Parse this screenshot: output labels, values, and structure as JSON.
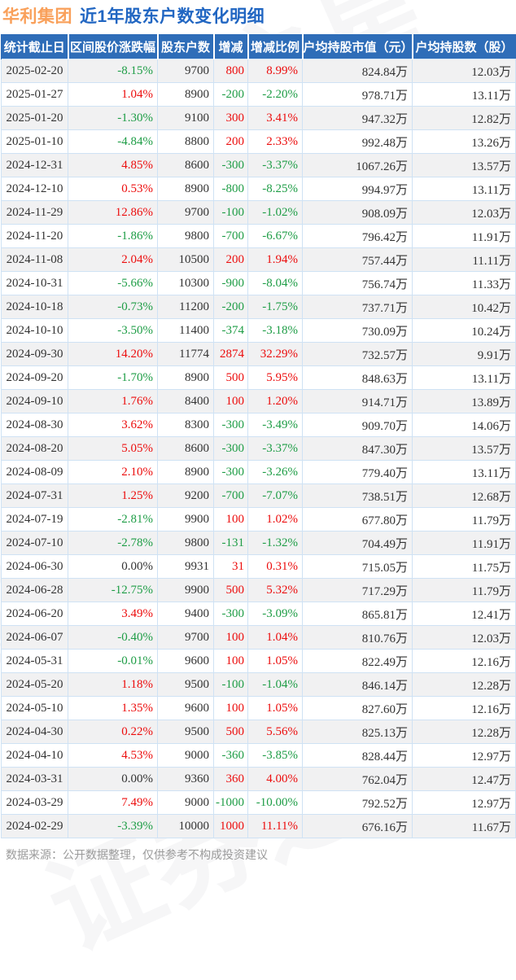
{
  "title": {
    "stock_name": "华利集团",
    "subtitle": "近1年股东户数变化明细"
  },
  "watermark": {
    "text": "证券之星"
  },
  "table": {
    "columns": [
      "统计截止日",
      "区间股价涨跌幅",
      "股东户数",
      "增减",
      "增减比例",
      "户均持股市值（元）",
      "户均持股数（股）"
    ],
    "rows": [
      [
        "2025-02-20",
        "-8.15%",
        "9700",
        "800",
        "8.99%",
        "824.84万",
        "12.03万"
      ],
      [
        "2025-01-27",
        "1.04%",
        "8900",
        "-200",
        "-2.20%",
        "978.71万",
        "13.11万"
      ],
      [
        "2025-01-20",
        "-1.30%",
        "9100",
        "300",
        "3.41%",
        "947.32万",
        "12.82万"
      ],
      [
        "2025-01-10",
        "-4.84%",
        "8800",
        "200",
        "2.33%",
        "992.48万",
        "13.26万"
      ],
      [
        "2024-12-31",
        "4.85%",
        "8600",
        "-300",
        "-3.37%",
        "1067.26万",
        "13.57万"
      ],
      [
        "2024-12-10",
        "0.53%",
        "8900",
        "-800",
        "-8.25%",
        "994.97万",
        "13.11万"
      ],
      [
        "2024-11-29",
        "12.86%",
        "9700",
        "-100",
        "-1.02%",
        "908.09万",
        "12.03万"
      ],
      [
        "2024-11-20",
        "-1.86%",
        "9800",
        "-700",
        "-6.67%",
        "796.42万",
        "11.91万"
      ],
      [
        "2024-11-08",
        "2.04%",
        "10500",
        "200",
        "1.94%",
        "757.44万",
        "11.11万"
      ],
      [
        "2024-10-31",
        "-5.66%",
        "10300",
        "-900",
        "-8.04%",
        "756.74万",
        "11.33万"
      ],
      [
        "2024-10-18",
        "-0.73%",
        "11200",
        "-200",
        "-1.75%",
        "737.71万",
        "10.42万"
      ],
      [
        "2024-10-10",
        "-3.50%",
        "11400",
        "-374",
        "-3.18%",
        "730.09万",
        "10.24万"
      ],
      [
        "2024-09-30",
        "14.20%",
        "11774",
        "2874",
        "32.29%",
        "732.57万",
        "9.91万"
      ],
      [
        "2024-09-20",
        "-1.70%",
        "8900",
        "500",
        "5.95%",
        "848.63万",
        "13.11万"
      ],
      [
        "2024-09-10",
        "1.76%",
        "8400",
        "100",
        "1.20%",
        "914.71万",
        "13.89万"
      ],
      [
        "2024-08-30",
        "3.62%",
        "8300",
        "-300",
        "-3.49%",
        "909.70万",
        "14.06万"
      ],
      [
        "2024-08-20",
        "5.05%",
        "8600",
        "-300",
        "-3.37%",
        "847.30万",
        "13.57万"
      ],
      [
        "2024-08-09",
        "2.10%",
        "8900",
        "-300",
        "-3.26%",
        "779.40万",
        "13.11万"
      ],
      [
        "2024-07-31",
        "1.25%",
        "9200",
        "-700",
        "-7.07%",
        "738.51万",
        "12.68万"
      ],
      [
        "2024-07-19",
        "-2.81%",
        "9900",
        "100",
        "1.02%",
        "677.80万",
        "11.79万"
      ],
      [
        "2024-07-10",
        "-2.78%",
        "9800",
        "-131",
        "-1.32%",
        "704.49万",
        "11.91万"
      ],
      [
        "2024-06-30",
        "0.00%",
        "9931",
        "31",
        "0.31%",
        "715.05万",
        "11.75万"
      ],
      [
        "2024-06-28",
        "-12.75%",
        "9900",
        "500",
        "5.32%",
        "717.29万",
        "11.79万"
      ],
      [
        "2024-06-20",
        "3.49%",
        "9400",
        "-300",
        "-3.09%",
        "865.81万",
        "12.41万"
      ],
      [
        "2024-06-07",
        "-0.40%",
        "9700",
        "100",
        "1.04%",
        "810.76万",
        "12.03万"
      ],
      [
        "2024-05-31",
        "-0.01%",
        "9600",
        "100",
        "1.05%",
        "822.49万",
        "12.16万"
      ],
      [
        "2024-05-20",
        "1.18%",
        "9500",
        "-100",
        "-1.04%",
        "846.14万",
        "12.28万"
      ],
      [
        "2024-05-10",
        "1.35%",
        "9600",
        "100",
        "1.05%",
        "827.60万",
        "12.16万"
      ],
      [
        "2024-04-30",
        "0.22%",
        "9500",
        "500",
        "5.56%",
        "825.13万",
        "12.28万"
      ],
      [
        "2024-04-10",
        "4.53%",
        "9000",
        "-360",
        "-3.85%",
        "828.44万",
        "12.97万"
      ],
      [
        "2024-03-31",
        "0.00%",
        "9360",
        "360",
        "4.00%",
        "762.04万",
        "12.47万"
      ],
      [
        "2024-03-29",
        "7.49%",
        "9000",
        "-1000",
        "-10.00%",
        "792.52万",
        "12.97万"
      ],
      [
        "2024-02-29",
        "-3.39%",
        "10000",
        "1000",
        "11.11%",
        "676.16万",
        "11.67万"
      ]
    ]
  },
  "footer": {
    "note": "数据来源：公开数据整理，仅供参考不构成投资建议"
  },
  "colors": {
    "up_red": "#ec0d0d",
    "down_green": "#1e9d46",
    "header_bg": "#2e6db8",
    "title_blue": "#2166c2",
    "stock_orange": "#f9a05a"
  }
}
